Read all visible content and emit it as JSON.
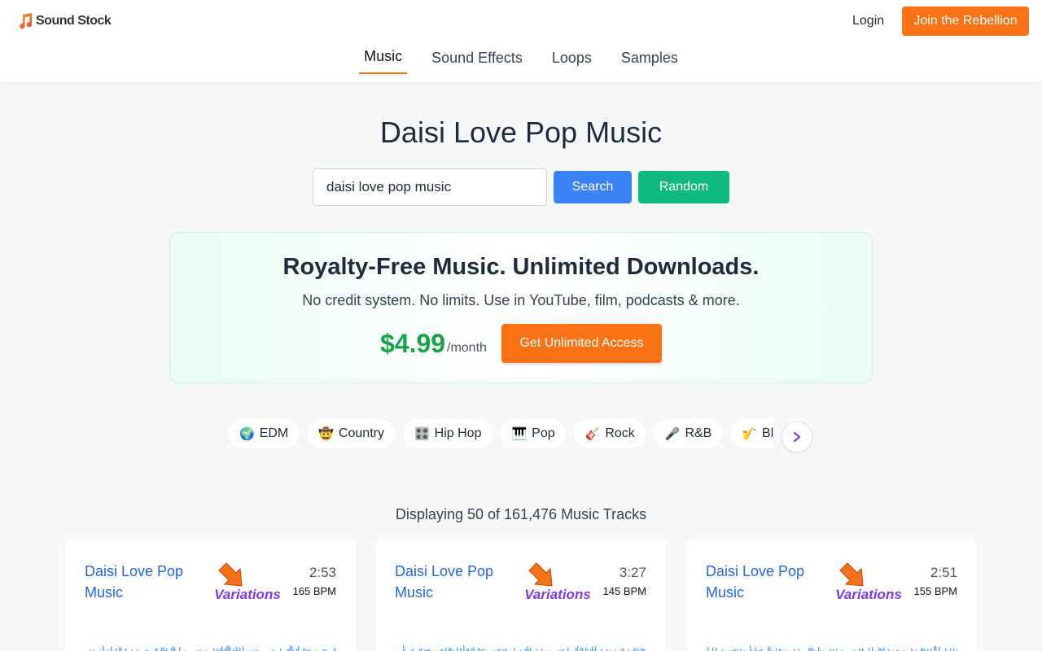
{
  "header": {
    "logo_text": "Sound Stock",
    "logo_icon": "music-note-icon",
    "login": "Login",
    "join": "Join the Rebellion",
    "accent": "#f97316"
  },
  "nav": {
    "items": [
      "Music",
      "Sound Effects",
      "Loops",
      "Samples"
    ],
    "active": "Music"
  },
  "page_title": "Daisi Love Pop Music",
  "search": {
    "value": "daisi love pop music",
    "button": "Search",
    "random": "Random"
  },
  "promo": {
    "title": "Royalty-Free Music. Unlimited Downloads.",
    "subtitle": "No credit system. No limits. Use in YouTube, film, podcasts & more.",
    "price": "$4.99",
    "per": "/month",
    "button": "Get Unlimited Access"
  },
  "genres": [
    {
      "emoji": "🌍",
      "label": "EDM"
    },
    {
      "emoji": "🤠",
      "label": "Country"
    },
    {
      "emoji": "🎛️",
      "label": "Hip Hop"
    },
    {
      "emoji": "🎹",
      "label": "Pop"
    },
    {
      "emoji": "🎸",
      "label": "Rock"
    },
    {
      "emoji": "🎤",
      "label": "R&B"
    },
    {
      "emoji": "🎷",
      "label": "Blues"
    }
  ],
  "results_count": "Displaying 50 of 161,476 Music Tracks",
  "tracks": [
    {
      "title": "Daisi Love Pop Music",
      "duration": "2:53",
      "bpm": "165 BPM",
      "badge": "Variations"
    },
    {
      "title": "Daisi Love Pop Music",
      "duration": "3:27",
      "bpm": "145 BPM",
      "badge": "Variations"
    },
    {
      "title": "Daisi Love Pop Music",
      "duration": "2:51",
      "bpm": "155 BPM",
      "badge": "Variations"
    }
  ]
}
